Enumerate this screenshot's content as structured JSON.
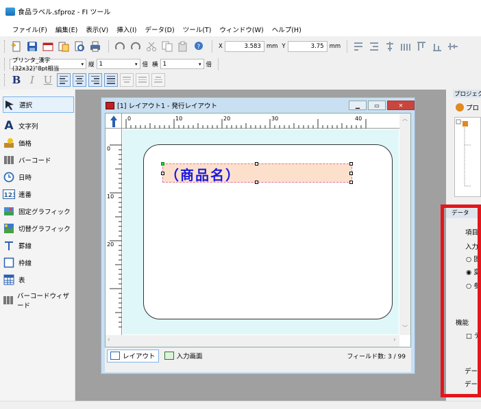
{
  "window": {
    "title": "食品ラベル.sfproz - FI ツール"
  },
  "menu": [
    "ファイル(F)",
    "編集(E)",
    "表示(V)",
    "挿入(I)",
    "データ(D)",
    "ツール(T)",
    "ウィンドウ(W)",
    "ヘルプ(H)"
  ],
  "toolbar": {
    "x_label": "X",
    "x_value": "3.583",
    "x_unit": "mm",
    "y_label": "Y",
    "y_value": "3.75",
    "y_unit": "mm"
  },
  "fontbar": {
    "font": "プリンタ_漢字(32x32)\"8pt相当",
    "tate_label": "縦",
    "tate_value": "1",
    "bai1": "倍",
    "yoko_label": "横",
    "yoko_value": "1",
    "bai2": "倍"
  },
  "tools": [
    {
      "label": "選択",
      "icon": "select-arrow-icon"
    },
    {
      "label": "文字列",
      "icon": "text-a-icon"
    },
    {
      "label": "価格",
      "icon": "price-icon"
    },
    {
      "label": "バーコード",
      "icon": "barcode-icon"
    },
    {
      "label": "日時",
      "icon": "clock-icon"
    },
    {
      "label": "連番",
      "icon": "sequence-123-icon"
    },
    {
      "label": "固定グラフィック",
      "icon": "fixed-graphic-icon"
    },
    {
      "label": "切替グラフィック",
      "icon": "switch-graphic-icon"
    },
    {
      "label": "罫線",
      "icon": "rule-line-icon"
    },
    {
      "label": "枠線",
      "icon": "frame-icon"
    },
    {
      "label": "表",
      "icon": "table-icon"
    },
    {
      "label": "バーコードウィザード",
      "icon": "barcode-wizard-icon"
    }
  ],
  "layout_window": {
    "title": "[1] レイアウト1 - 発行レイアウト",
    "ruler_top": [
      "0",
      "10",
      "20",
      "30",
      "40"
    ],
    "ruler_left": [
      "0",
      "10",
      "20"
    ],
    "field_text": "（商品名）",
    "tab_layout": "レイアウト",
    "tab_input": "入力画面",
    "field_count": "フィールド数: 3 / 99"
  },
  "right_panel": {
    "project_header": "プロジェクト",
    "project_item": "プロ",
    "data_header": "データ",
    "item_label": "項目:",
    "input_label": "入力",
    "radio1": "○ 固",
    "radio2": "◉ 変",
    "radio3": "○ 参",
    "func_label": "機能",
    "check1": "□ デ",
    "data_label2": "データ",
    "data_label3": "データ"
  },
  "colors": {
    "highlight": "#e4161b",
    "canvas": "#e0f7fa",
    "field_text": "#1a1adf"
  }
}
